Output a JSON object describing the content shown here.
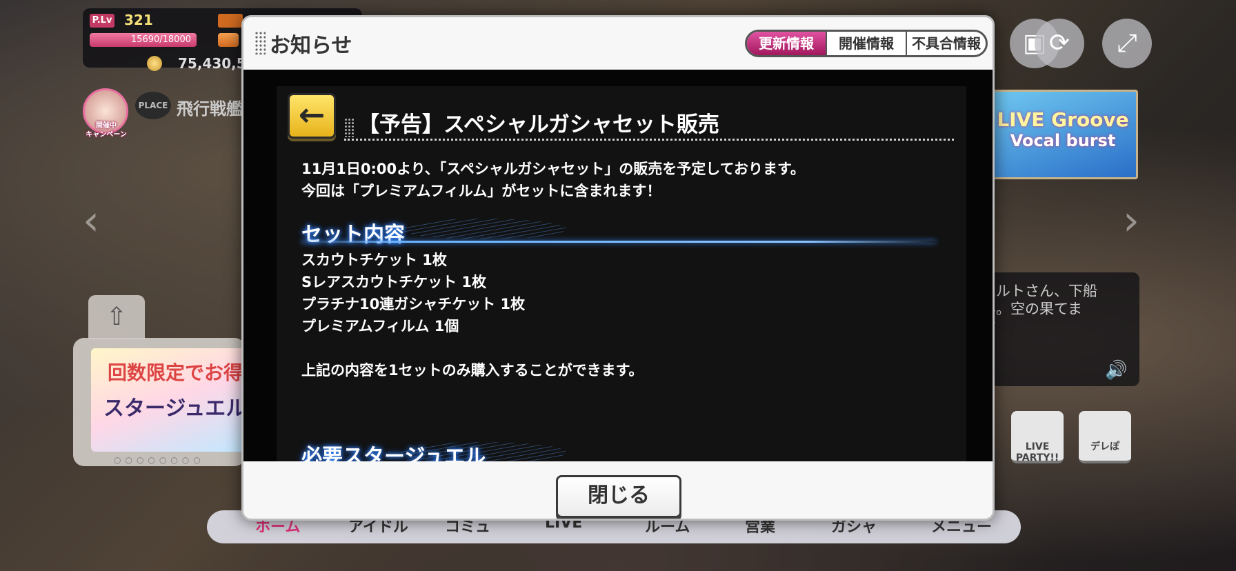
{
  "hud": {
    "plv_label": "P.Lv",
    "plv_value": "321",
    "exp": "15690/18000",
    "money": "75,430,5"
  },
  "campaign": {
    "label": "開催中\nキャンペーン"
  },
  "place": {
    "badge": "PLACE",
    "name": "飛行戦艦"
  },
  "promo": {
    "line1": "回数限定でお得",
    "line2": "スタージュエル販"
  },
  "live_banner": {
    "line1": "LIVE Groove",
    "line2": "Vocal burst"
  },
  "chat": {
    "text": "ンハルトさん、下船\nせん。空の果てま\nです"
  },
  "side_buttons": [
    {
      "label": "LIVE\nPARTY!!"
    },
    {
      "label": "デレぽ"
    }
  ],
  "bottom_nav": [
    "ホーム",
    "アイドル",
    "コミュ",
    "LIVE",
    "ルーム",
    "営業",
    "ガシャ",
    "メニュー"
  ],
  "modal": {
    "title": "お知らせ",
    "tabs": [
      {
        "label": "更新情報",
        "active": true
      },
      {
        "label": "開催情報",
        "active": false
      },
      {
        "label": "不具合情報",
        "active": false
      }
    ],
    "back_icon": "←",
    "article": {
      "title": "【予告】スペシャルガシャセット販売",
      "intro1": "11月1日0:00より、「スペシャルガシャセット」の販売を予定しております。",
      "intro2": "今回は「プレミアムフィルム」がセットに含まれます！",
      "section1": "セット内容",
      "items": [
        "スカウトチケット 1枚",
        "Sレアスカウトチケット 1枚",
        "プラチナ10連ガシャチケット 1枚",
        "プレミアムフィルム 1個"
      ],
      "note": "上記の内容を1セットのみ購入することができます。",
      "section2": "必要スタージュエル"
    },
    "close_label": "閉じる"
  }
}
